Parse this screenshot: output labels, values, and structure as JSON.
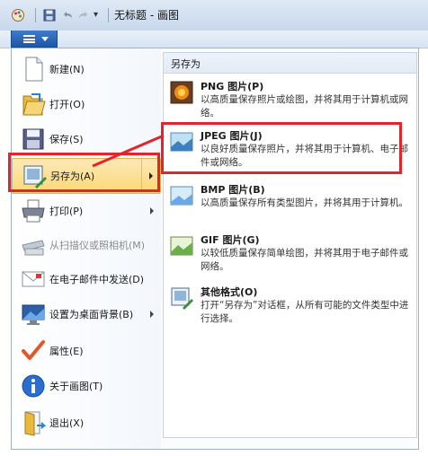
{
  "window": {
    "title": "无标题 - 画图",
    "qat_dropdown": "▾"
  },
  "menu": {
    "items": [
      {
        "label": "新建(N)"
      },
      {
        "label": "打开(O)"
      },
      {
        "label": "保存(S)"
      },
      {
        "label": "另存为(A)"
      },
      {
        "label": "打印(P)"
      },
      {
        "label": "从扫描仪或照相机(M)"
      },
      {
        "label": "在电子邮件中发送(D)"
      },
      {
        "label": "设置为桌面背景(B)"
      },
      {
        "label": "属性(E)"
      },
      {
        "label": "关于画图(T)"
      },
      {
        "label": "退出(X)"
      }
    ]
  },
  "saveas": {
    "header": "另存为",
    "items": [
      {
        "title": "PNG 图片(P)",
        "desc": "以高质量保存照片或绘图，并将其用于计算机或网络。"
      },
      {
        "title": "JPEG 图片(J)",
        "desc": "以良好质量保存照片，并将其用于计算机、电子邮件或网络。"
      },
      {
        "title": "BMP 图片(B)",
        "desc": "以高质量保存所有类型图片，并将其用于计算机。"
      },
      {
        "title": "GIF 图片(G)",
        "desc": "以较低质量保存简单绘图，并将其用于电子邮件或网络。"
      },
      {
        "title": "其他格式(O)",
        "desc": "打开“另存为”对话框，从所有可能的文件类型中进行选择。"
      }
    ]
  },
  "colors": {
    "highlight": "#fbd774",
    "callout": "#e4232b",
    "app_button": "#1f56a8"
  }
}
